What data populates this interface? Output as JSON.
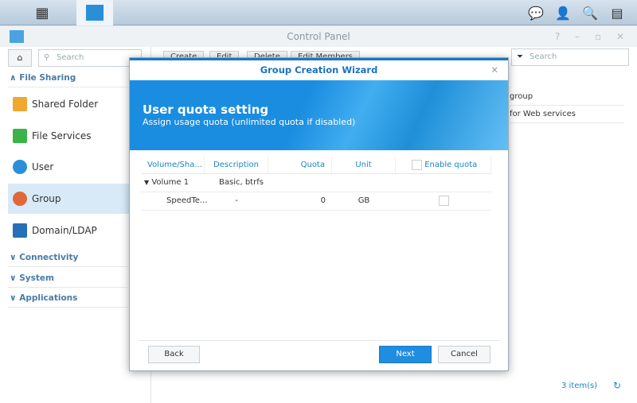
{
  "window": {
    "title": "Control Panel"
  },
  "sidebar": {
    "search_placeholder": "Search",
    "categories": [
      {
        "label": "File Sharing"
      },
      {
        "label": "Connectivity"
      },
      {
        "label": "System"
      },
      {
        "label": "Applications"
      }
    ],
    "items": [
      {
        "label": "Shared Folder",
        "color": "#f0a830"
      },
      {
        "label": "File Services",
        "color": "#3bb34a"
      },
      {
        "label": "User",
        "color": "#2a8fd8"
      },
      {
        "label": "Group",
        "color": "#e0673a"
      },
      {
        "label": "Domain/LDAP",
        "color": "#2570b8"
      }
    ]
  },
  "toolbar": {
    "create": "Create",
    "edit": "Edit",
    "delete": "Delete",
    "edit_members": "Edit Members",
    "filter_placeholder": "Search"
  },
  "background_rows": [
    "group",
    "for Web services"
  ],
  "status": {
    "count": "3 item(s)"
  },
  "wizard": {
    "title": "Group Creation Wizard",
    "heading": "User quota setting",
    "subheading": "Assign usage quota (unlimited quota if disabled)",
    "columns": [
      "Volume/Sha...",
      "Description",
      "Quota",
      "Unit",
      "Enable quota"
    ],
    "volume": {
      "name": "Volume 1",
      "description": "Basic, btrfs"
    },
    "rows": [
      {
        "share": "SpeedTe...",
        "description": "-",
        "quota": "0",
        "unit": "GB",
        "enabled": false
      }
    ],
    "back": "Back",
    "next": "Next",
    "cancel": "Cancel"
  }
}
